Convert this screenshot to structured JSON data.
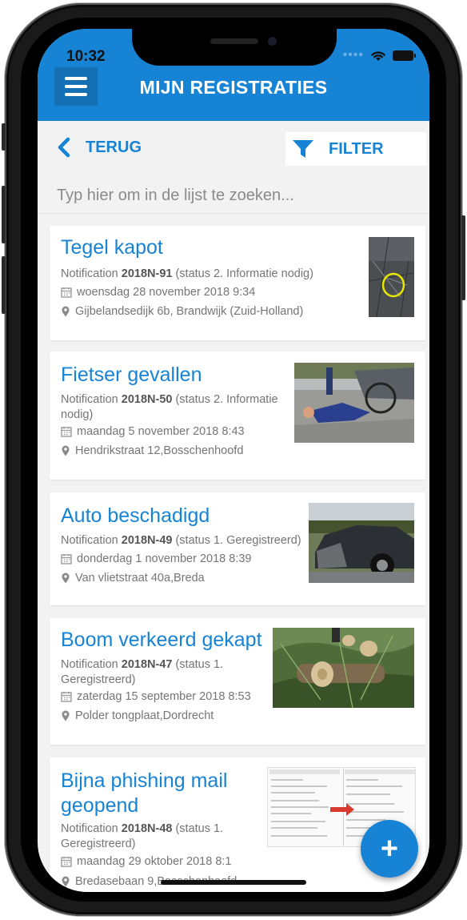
{
  "status_bar": {
    "time": "10:32"
  },
  "header": {
    "title": "MIJN REGISTRATIES"
  },
  "toolbar": {
    "back_label": "TERUG",
    "filter_label": "FILTER"
  },
  "search": {
    "placeholder": "Typ hier om in de lijst te zoeken..."
  },
  "items": [
    {
      "title": "Tegel kapot",
      "meta_prefix": "Notification ",
      "number": "2018N-91",
      "status_text": " (status 2. Informatie nodig)",
      "date": "woensdag 28 november 2018 9:34",
      "address": "Gijbelandsedijk 6b, Brandwijk (Zuid-Holland)"
    },
    {
      "title": "Fietser gevallen",
      "meta_prefix": "Notification ",
      "number": "2018N-50",
      "status_text": " (status 2. Informatie nodig)",
      "date": "maandag 5 november 2018 8:43",
      "address": "Hendrikstraat 12,Bosschenhoofd"
    },
    {
      "title": "Auto beschadigd",
      "meta_prefix": "Notification ",
      "number": "2018N-49",
      "status_text": " (status 1. Geregistreerd)",
      "date": "donderdag 1 november 2018 8:39",
      "address": "Van vlietstraat 40a,Breda"
    },
    {
      "title": "Boom verkeerd gekapt",
      "meta_prefix": "Notification ",
      "number": "2018N-47",
      "status_text": " (status 1. Geregistreerd)",
      "date": "zaterdag 15 september 2018 8:53",
      "address": "Polder tongplaat,Dordrecht"
    },
    {
      "title": "Bijna phishing mail geopend",
      "meta_prefix": "Notification ",
      "number": "2018N-48",
      "status_text": " (status 1. Geregistreerd)",
      "date": "maandag 29 oktober 2018 8:1",
      "address": "Bredasebaan 9,Bosschenhoofd"
    }
  ],
  "fab": {
    "label": "+"
  },
  "icons": {
    "menu": "menu-icon",
    "back": "chevron-left-icon",
    "filter": "filter-icon",
    "calendar": "calendar-icon",
    "location": "map-pin-icon",
    "add": "plus-icon"
  },
  "colors": {
    "accent": "#1783d4",
    "header_dark": "#146fb5",
    "background": "#f2f2f2"
  }
}
